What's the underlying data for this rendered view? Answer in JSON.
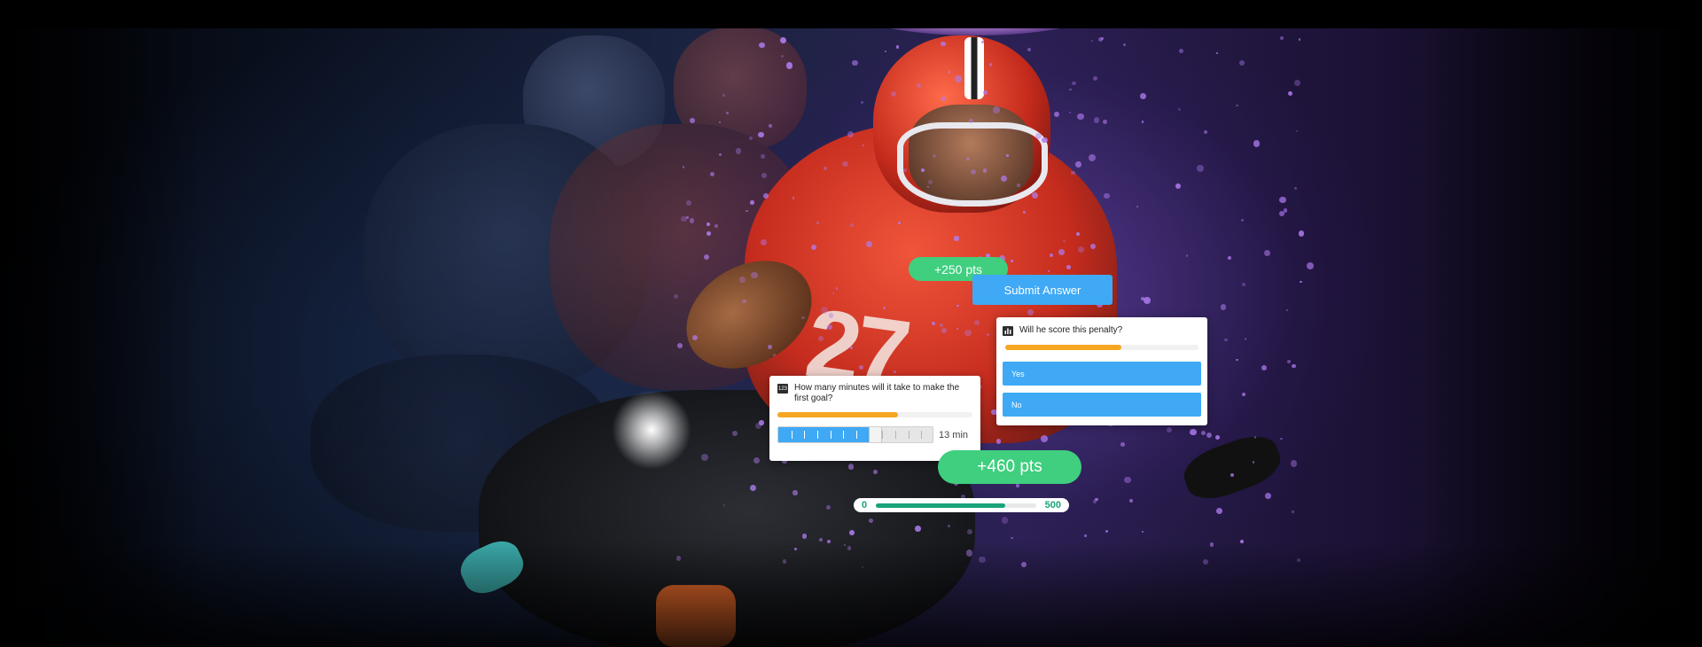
{
  "hero": {
    "jersey_number": "27"
  },
  "rewards": {
    "points_small": "+250 pts",
    "points_big": "+460 pts"
  },
  "submit": {
    "label": "Submit Answer"
  },
  "poll_card": {
    "icon": "bar-chart-icon",
    "question": "Will he score this penalty?",
    "timer_fraction": 0.6,
    "options": [
      {
        "label": "Yes"
      },
      {
        "label": "No"
      }
    ]
  },
  "slider_card": {
    "icon": "number-123-icon",
    "icon_text": "123",
    "question": "How many minutes will it take to make the first goal?",
    "timer_fraction": 0.62,
    "slider_fraction": 0.62,
    "value_label": "13 min"
  },
  "score_bar": {
    "min_label": "0",
    "max_label": "500",
    "fill_fraction": 0.81
  },
  "colors": {
    "accent_blue": "#3fa9f5",
    "accent_green": "#3fcf7f",
    "timer_orange": "#f5a623",
    "score_teal": "#1aa37a"
  }
}
